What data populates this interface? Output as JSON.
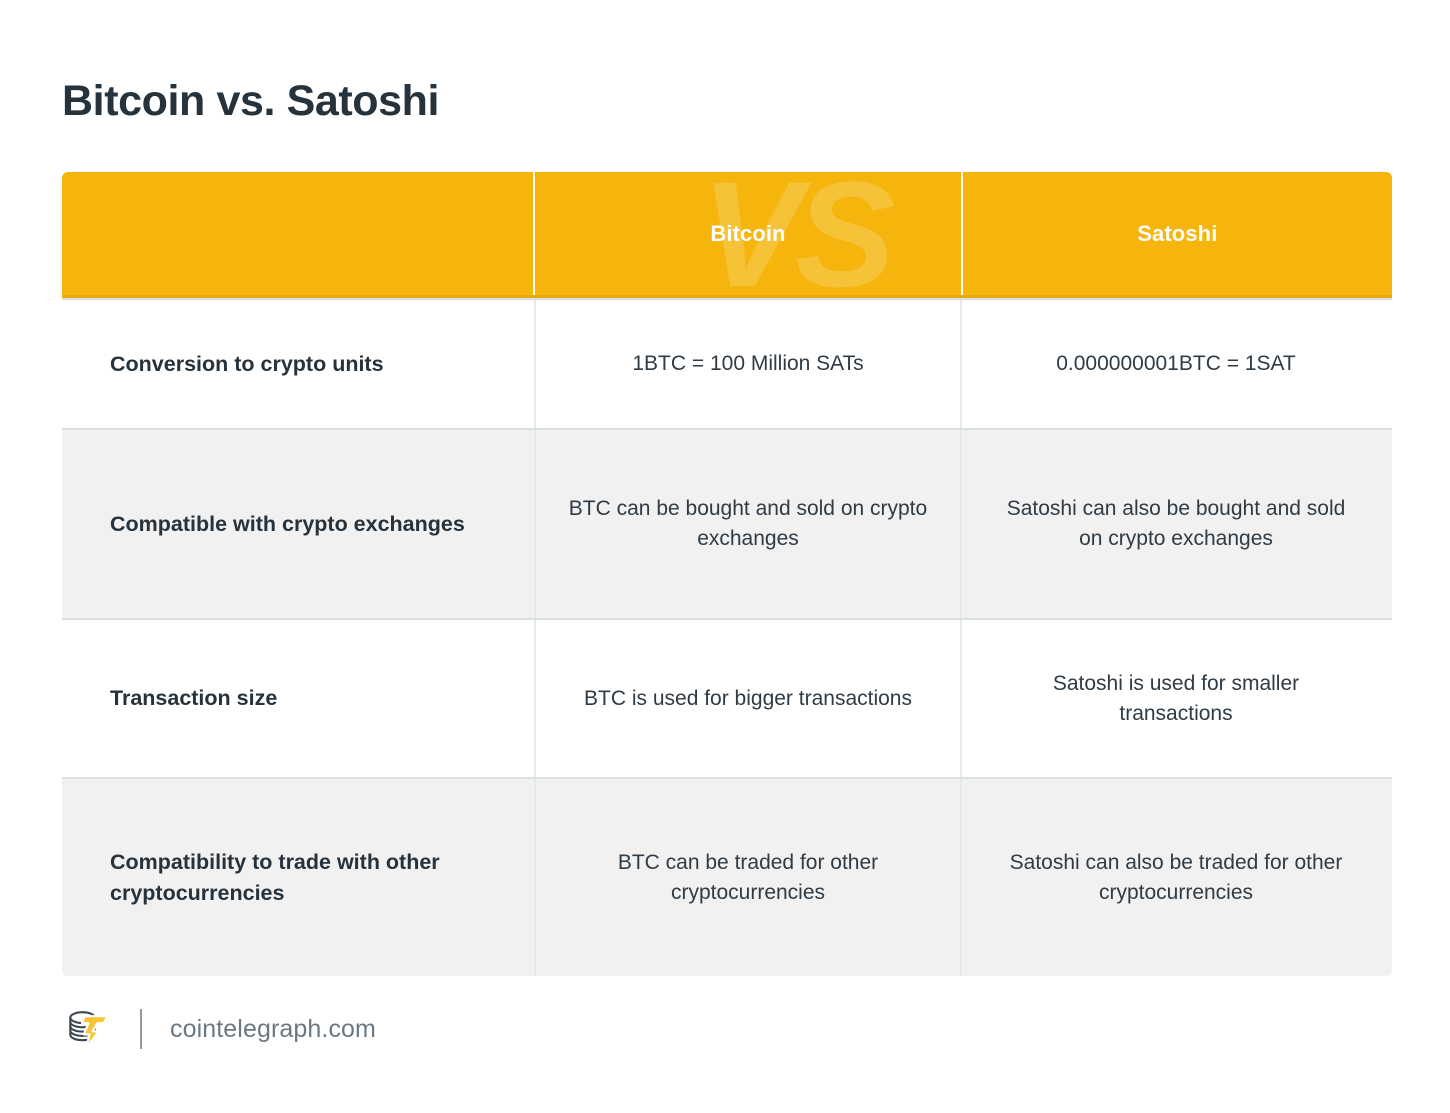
{
  "page": {
    "title": "Bitcoin vs. Satoshi",
    "background_color": "#ffffff"
  },
  "theme": {
    "accent_yellow": "#f5b50d",
    "accent_yellow_dark": "#e8ab0b",
    "watermark_text": "VS",
    "text_dark": "#26323c",
    "text_body": "#2f3b45",
    "row_alt_background": "#f1f1f1",
    "row_divider": "#d8e0e4",
    "footer_text_color": "#6b7882"
  },
  "table": {
    "headers": {
      "label_column": "",
      "column_a": "Bitcoin",
      "column_b": "Satoshi"
    },
    "rows": [
      {
        "label": "Conversion to crypto units",
        "bitcoin": "1BTC = 100 Million SATs",
        "satoshi": "0.000000001BTC = 1SAT",
        "shaded": false
      },
      {
        "label": "Compatible with crypto exchanges",
        "bitcoin": "BTC can be bought and sold on crypto exchanges",
        "satoshi": "Satoshi can also be bought and sold on crypto exchanges",
        "shaded": true
      },
      {
        "label": "Transaction size",
        "bitcoin": "BTC is used for bigger transactions",
        "satoshi": "Satoshi is used for smaller transactions",
        "shaded": false
      },
      {
        "label": "Compatibility to trade with other cryptocurrencies",
        "bitcoin": "BTC can be traded for other cryptocurrencies",
        "satoshi": "Satoshi can also be traded for other cryptocurrencies",
        "shaded": true
      }
    ]
  },
  "footer": {
    "logo_name": "cointelegraph-coin-stack-lightning-logo",
    "site": "cointelegraph.com"
  }
}
